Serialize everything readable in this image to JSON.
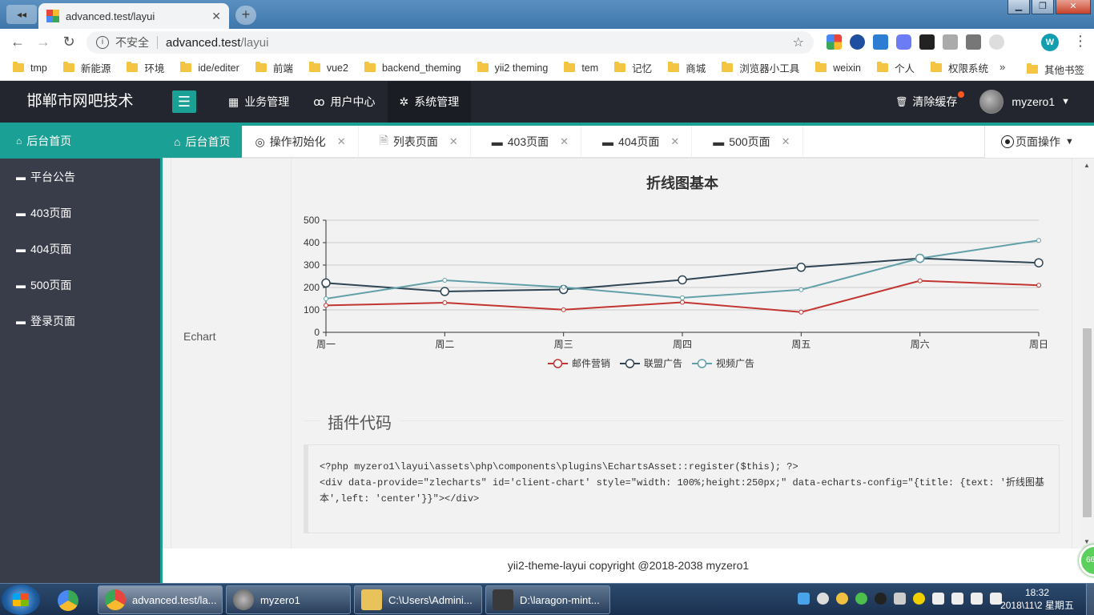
{
  "browser": {
    "tab_title": "advanced.test/layui",
    "url_insecure": "不安全",
    "url_host": "advanced.test",
    "url_path": "/layui",
    "profile_initial": "W",
    "bookmarks": [
      "tmp",
      "新能源",
      "环境",
      "ide/editer",
      "前端",
      "vue2",
      "backend_theming",
      "yii2 theming",
      "tem",
      "记忆",
      "商城",
      "浏览器小工具",
      "weixin",
      "个人",
      "权限系统"
    ],
    "bookmarks_more": "»",
    "bookmarks_other": "其他书签"
  },
  "header": {
    "logo": "邯郸市网吧技术",
    "nav": [
      "业务管理",
      "用户中心",
      "系统管理"
    ],
    "clear_cache": "清除缓存",
    "username": "myzero1"
  },
  "sidebar": {
    "items": [
      "后台首页",
      "平台公告",
      "403页面",
      "404页面",
      "500页面",
      "登录页面"
    ]
  },
  "pagetabs": {
    "items": [
      "后台首页",
      "操作初始化",
      "列表页面",
      "403页面",
      "404页面",
      "500页面"
    ],
    "ops": "页面操作"
  },
  "main": {
    "row_label": "Echart",
    "plugin_title": "插件代码",
    "code_line1": "<?php myzero1\\layui\\assets\\php\\components\\plugins\\EchartsAsset::register($this); ?>",
    "code_line2": "<div data-provide=\"zlecharts\" id='client-chart' style=\"width: 100%;height:250px;\" data-echarts-config=\"{title: {text: '折线图基本',left: 'center'}}\"></div>"
  },
  "chart_data": {
    "type": "line",
    "title": "折线图基本",
    "categories": [
      "周一",
      "周二",
      "周三",
      "周四",
      "周五",
      "周六",
      "周日"
    ],
    "ylim": [
      0,
      500
    ],
    "yticks": [
      0,
      100,
      200,
      300,
      400,
      500
    ],
    "grid": true,
    "legend_position": "bottom",
    "series": [
      {
        "name": "邮件营销",
        "color": "#c23531",
        "values": [
          120,
          132,
          101,
          134,
          90,
          230,
          210
        ]
      },
      {
        "name": "联盟广告",
        "color": "#2f4554",
        "values": [
          220,
          182,
          191,
          234,
          290,
          330,
          310
        ]
      },
      {
        "name": "视频广告",
        "color": "#61a0a8",
        "values": [
          150,
          232,
          201,
          154,
          190,
          330,
          410
        ]
      }
    ]
  },
  "footer": "yii2-theme-layui copyright @2018-2038 myzero1",
  "float_badge": "66",
  "taskbar": {
    "buttons": [
      "advanced.test/la...",
      "myzero1",
      "C:\\Users\\Admini...",
      "D:\\laragon-mint..."
    ],
    "time": "18:32",
    "date": "2018\\11\\2 星期五"
  },
  "colors": {
    "accent": "#1aa094",
    "header_bg": "#23262e",
    "sidebar_bg": "#393d49"
  }
}
